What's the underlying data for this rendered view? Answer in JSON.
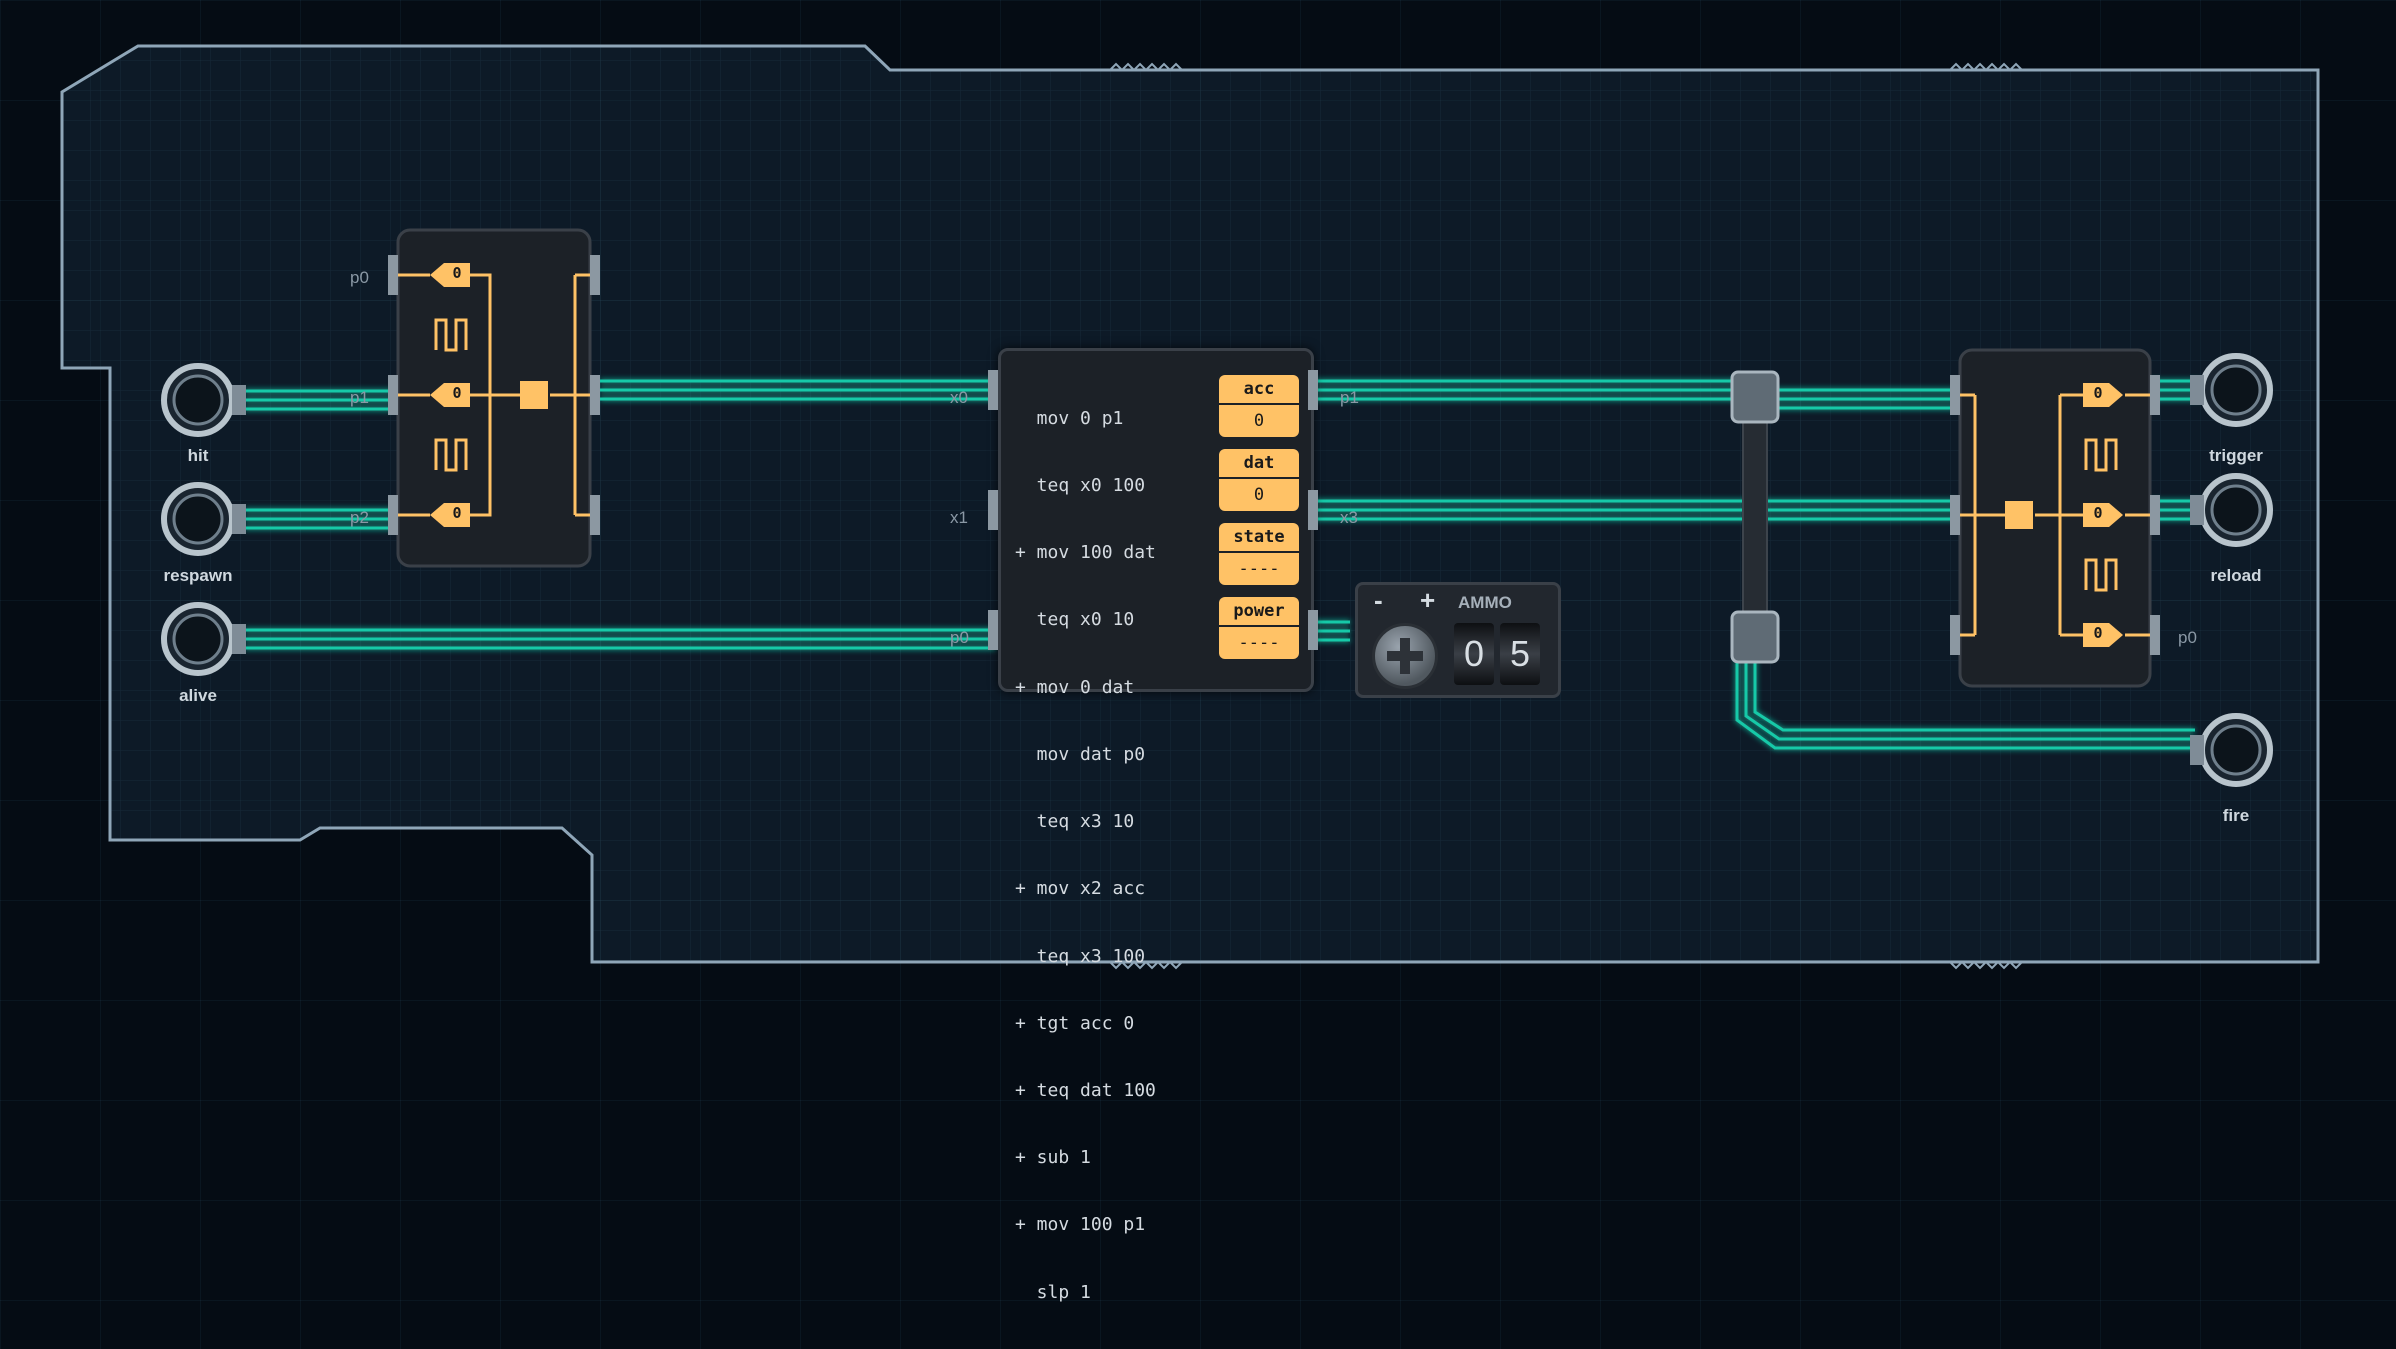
{
  "inputs": [
    {
      "id": "hit",
      "label": "hit"
    },
    {
      "id": "respawn",
      "label": "respawn"
    },
    {
      "id": "alive",
      "label": "alive"
    }
  ],
  "outputs": [
    {
      "id": "trigger",
      "label": "trigger"
    },
    {
      "id": "reload",
      "label": "reload"
    },
    {
      "id": "fire",
      "label": "fire"
    }
  ],
  "left_chip": {
    "left_ports": [
      "p0",
      "p1",
      "p2"
    ],
    "values": [
      "0",
      "0",
      "0"
    ]
  },
  "main_chip": {
    "left_ports": [
      "x0",
      "x1",
      "p0"
    ],
    "right_ports": [
      "p1",
      "x3"
    ],
    "code": [
      "  mov 0 p1",
      "  teq x0 100",
      "+ mov 100 dat",
      "  teq x0 10",
      "+ mov 0 dat",
      "  mov dat p0",
      "  teq x3 10",
      "+ mov x2 acc",
      "  teq x3 100",
      "+ tgt acc 0",
      "+ teq dat 100",
      "+ sub 1",
      "+ mov 100 p1",
      "  slp 1"
    ],
    "registers": [
      {
        "name": "acc",
        "value": "0"
      },
      {
        "name": "dat",
        "value": "0"
      },
      {
        "name": "state",
        "value": "----"
      },
      {
        "name": "power",
        "value": "----"
      }
    ]
  },
  "ammo": {
    "title": "AMMO",
    "minus": "-",
    "plus": "+",
    "digits": [
      "0",
      "5"
    ]
  },
  "right_chip": {
    "right_port": "p0",
    "values": [
      "0",
      "0",
      "0"
    ]
  },
  "colors": {
    "wire": "#19c9a8",
    "gate": "#ffc266",
    "board_border": "#8fa6b8"
  }
}
